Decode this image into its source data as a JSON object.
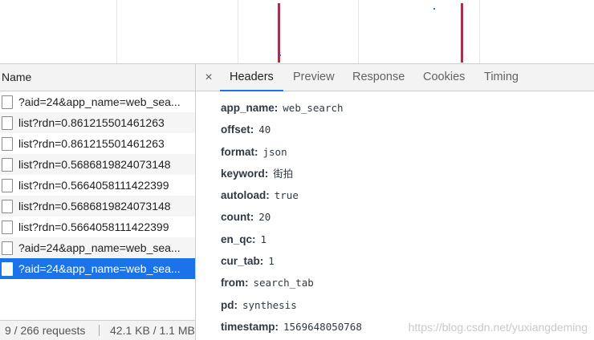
{
  "list": {
    "column_header": "Name",
    "requests": [
      {
        "name": "?aid=24&app_name=web_sea...",
        "selected": false
      },
      {
        "name": "list?rdn=0.861215501461263",
        "selected": false
      },
      {
        "name": "list?rdn=0.861215501461263",
        "selected": false
      },
      {
        "name": "list?rdn=0.5686819824073148",
        "selected": false
      },
      {
        "name": "list?rdn=0.5664058111422399",
        "selected": false
      },
      {
        "name": "list?rdn=0.5686819824073148",
        "selected": false
      },
      {
        "name": "list?rdn=0.5664058111422399",
        "selected": false
      },
      {
        "name": "?aid=24&app_name=web_sea...",
        "selected": false
      },
      {
        "name": "?aid=24&app_name=web_sea...",
        "selected": true
      }
    ]
  },
  "status": {
    "requests": "9 / 266 requests",
    "size": "42.1 KB / 1.1 MB"
  },
  "tabs": {
    "close": "×",
    "items": [
      "Headers",
      "Preview",
      "Response",
      "Cookies",
      "Timing"
    ],
    "active": "Headers"
  },
  "query_params": [
    {
      "key": "app_name:",
      "value": "web_search"
    },
    {
      "key": "offset:",
      "value": "40"
    },
    {
      "key": "format:",
      "value": "json"
    },
    {
      "key": "keyword:",
      "value": "街拍"
    },
    {
      "key": "autoload:",
      "value": "true"
    },
    {
      "key": "count:",
      "value": "20"
    },
    {
      "key": "en_qc:",
      "value": "1"
    },
    {
      "key": "cur_tab:",
      "value": "1"
    },
    {
      "key": "from:",
      "value": "search_tab"
    },
    {
      "key": "pd:",
      "value": "synthesis"
    },
    {
      "key": "timestamp:",
      "value": "1569648050768"
    }
  ],
  "watermark": "https://blog.csdn.net/yuxiangdeming",
  "colors": {
    "selection": "#1a73e8",
    "timeline_mark": "#a4324c"
  }
}
